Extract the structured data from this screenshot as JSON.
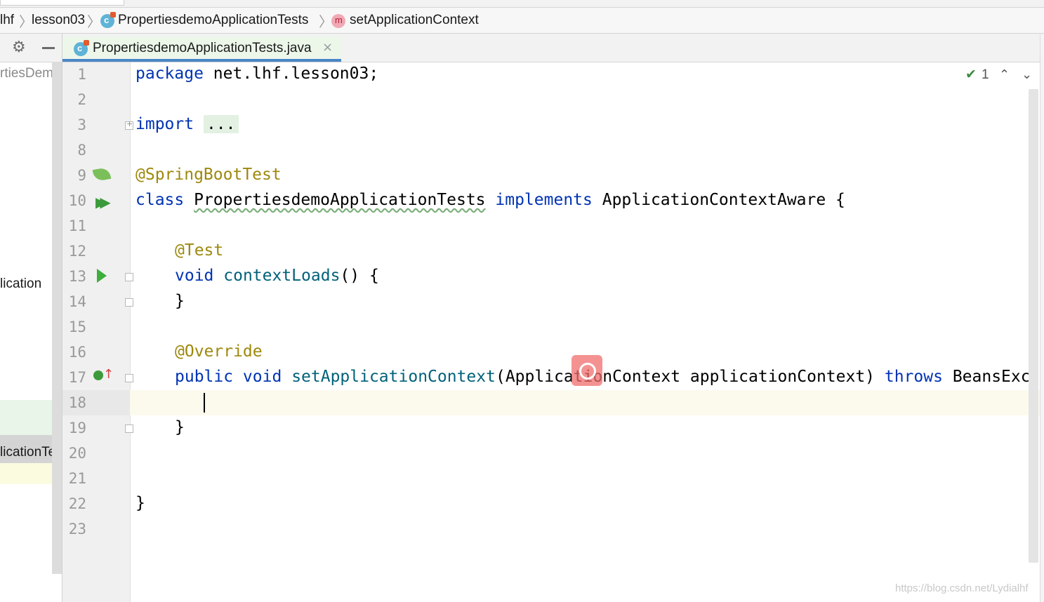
{
  "breadcrumb": {
    "items": [
      {
        "label": "lhf",
        "icon": null
      },
      {
        "label": "lesson03",
        "icon": null
      },
      {
        "label": "PropertiesdemoApplicationTests",
        "icon": "class-icon"
      },
      {
        "label": "setApplicationContext",
        "icon": "method-icon",
        "icon_letter": "m"
      }
    ],
    "class_icon_letter": "c"
  },
  "project_panel": {
    "rows": [
      {
        "text": "rtiesDemo",
        "style": "muted"
      },
      {
        "text": "lication",
        "style": "normal"
      },
      {
        "text": "licationTes",
        "style": "selected"
      }
    ]
  },
  "tab": {
    "label": "PropertiesdemoApplicationTests.java",
    "close": "×",
    "icon_letter": "c"
  },
  "inspection": {
    "count": "1",
    "up": "⌃",
    "down": "⌄"
  },
  "editor": {
    "current_line": "18",
    "lines": [
      {
        "n": "1"
      },
      {
        "n": "2"
      },
      {
        "n": "3"
      },
      {
        "n": "8"
      },
      {
        "n": "9"
      },
      {
        "n": "10"
      },
      {
        "n": "11"
      },
      {
        "n": "12"
      },
      {
        "n": "13"
      },
      {
        "n": "14"
      },
      {
        "n": "15"
      },
      {
        "n": "16"
      },
      {
        "n": "17"
      },
      {
        "n": "18"
      },
      {
        "n": "19"
      },
      {
        "n": "20"
      },
      {
        "n": "21"
      },
      {
        "n": "22"
      },
      {
        "n": "23"
      }
    ],
    "code": {
      "l1_kw": "package",
      "l1_rest": " net.lhf.lesson03;",
      "l3_kw": "import",
      "l3_fold": "...",
      "l9": "@SpringBootTest",
      "l10_kw": "class",
      "l10_name": "PropertiesdemoApplicationTests",
      "l10_impl": "implements",
      "l10_rest": " ApplicationContextAware {",
      "l12": "@Test",
      "l13_kw": "void",
      "l13_name": "contextLoads",
      "l13_rest": "() {",
      "l14": "}",
      "l16": "@Override",
      "l17_kw": "public void",
      "l17_name": "setApplicationContext",
      "l17_rest": "(ApplicationContext applicationContext) ",
      "l17_throws": "throws",
      "l17_tail": " BeansExc",
      "l19": "}",
      "l22": "}"
    }
  },
  "watermark": "https://blog.csdn.net/Lydialhf",
  "colors": {
    "keyword": "#0033b3",
    "annotation": "#9e880d",
    "method": "#00627a",
    "tab_underline": "#4a86c8",
    "current_line": "#fcfaed"
  }
}
